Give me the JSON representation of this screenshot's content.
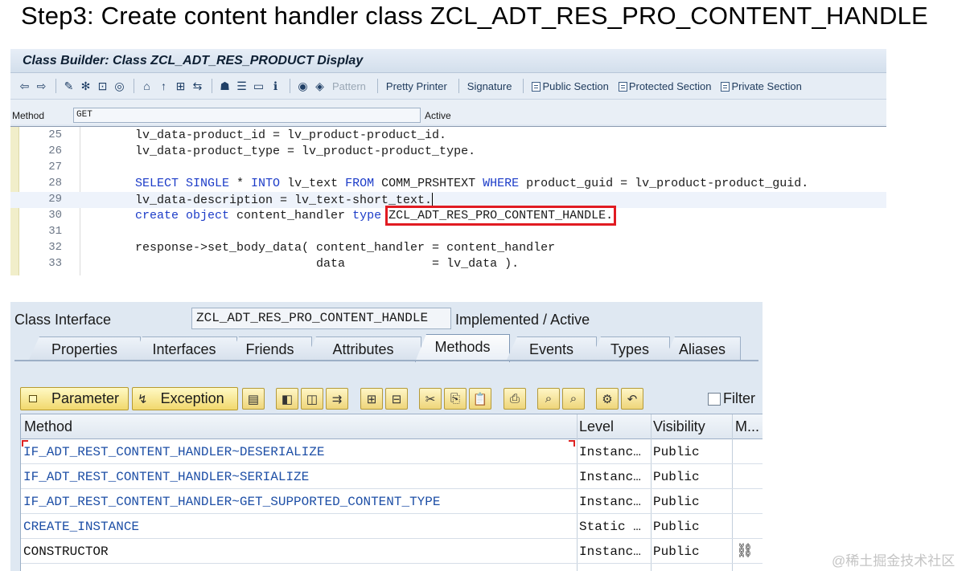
{
  "slide": {
    "title": "Step3: Create content handler class ZCL_ADT_RES_PRO_CONTENT_HANDLE"
  },
  "class_builder": {
    "title": "Class Builder: Class ZCL_ADT_RES_PRODUCT Display",
    "toolbar": {
      "pattern": "Pattern",
      "pretty_printer": "Pretty Printer",
      "signature": "Signature",
      "public_section": "Public Section",
      "protected_section": "Protected Section",
      "private_section": "Private Section"
    },
    "method_label": "Method",
    "method_value": "GET",
    "method_status": "Active",
    "code_lines": [
      {
        "num": "25",
        "a": "lv_data-product_id = lv_product-product_id.",
        "b": "",
        "c": ""
      },
      {
        "num": "26",
        "a": "lv_data-product_type = lv_product-product_type.",
        "b": "",
        "c": ""
      },
      {
        "num": "27",
        "a": "",
        "b": "",
        "c": ""
      },
      {
        "num": "28",
        "a": "",
        "b": "",
        "c": ""
      },
      {
        "num": "29",
        "a": "lv_data-description = lv_text-short_text.",
        "b": "",
        "c": ""
      },
      {
        "num": "30",
        "a": "",
        "b": "",
        "c": ""
      },
      {
        "num": "31",
        "a": "",
        "b": "",
        "c": ""
      },
      {
        "num": "32",
        "a": "response->set_body_data( content_handler = content_handler",
        "b": "",
        "c": ""
      },
      {
        "num": "33",
        "a": "                         data            = lv_data ).",
        "b": "",
        "c": ""
      }
    ],
    "line28": {
      "kw1": "SELECT SINGLE",
      "t1": " * ",
      "kw2": "INTO",
      "t2": " lv_text ",
      "kw3": "FROM",
      "t3": " COMM_PRSHTEXT ",
      "kw4": "WHERE",
      "t4": " product_guid = lv_product-product_guid."
    },
    "line30": {
      "kw1": "create object",
      "t1": " content_handler ",
      "kw2": "type",
      "highlight": "ZCL_ADT_RES_PRO_CONTENT_HANDLE."
    }
  },
  "class_interface": {
    "label": "Class Interface",
    "name": "ZCL_ADT_RES_PRO_CONTENT_HANDLE",
    "status": "Implemented / Active",
    "tabs": [
      "Properties",
      "Interfaces",
      "Friends",
      "Attributes",
      "Methods",
      "Events",
      "Types",
      "Aliases"
    ],
    "active_tab": "Methods",
    "toolbar": {
      "parameter": "Parameter",
      "exception": "Exception",
      "filter": "Filter"
    },
    "columns": {
      "method": "Method",
      "level": "Level",
      "visibility": "Visibility",
      "m": "M..."
    },
    "rows": [
      {
        "method": "IF_ADT_REST_CONTENT_HANDLER~DESERIALIZE",
        "level": "Instanc…",
        "visibility": "Public",
        "m": ""
      },
      {
        "method": "IF_ADT_REST_CONTENT_HANDLER~SERIALIZE",
        "level": "Instanc…",
        "visibility": "Public",
        "m": ""
      },
      {
        "method": "IF_ADT_REST_CONTENT_HANDLER~GET_SUPPORTED_CONTENT_TYPE",
        "level": "Instanc…",
        "visibility": "Public",
        "m": ""
      },
      {
        "method": "CREATE_INSTANCE",
        "level": "Static  …",
        "visibility": "Public",
        "m": ""
      },
      {
        "method": "CONSTRUCTOR",
        "level": "Instanc…",
        "visibility": "Public",
        "m": ""
      }
    ]
  },
  "watermark": "@稀土掘金技术社区"
}
